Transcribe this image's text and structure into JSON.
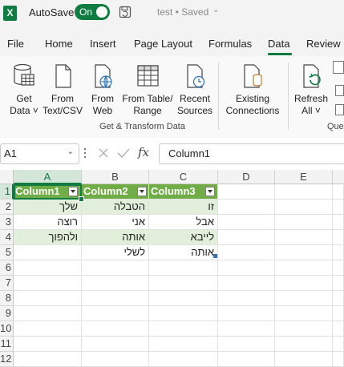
{
  "titlebar": {
    "app_icon": "X",
    "autosave_label": "AutoSave",
    "autosave_state": "On",
    "doc_title": "test • Saved",
    "icons": [
      "excel-logo-icon",
      "save-icon",
      "chevron-down-icon"
    ]
  },
  "tabs": [
    "File",
    "Home",
    "Insert",
    "Page Layout",
    "Formulas",
    "Data",
    "Review"
  ],
  "active_tab": "Data",
  "ribbon": {
    "buttons": [
      {
        "line1": "Get",
        "line2": "Data ˅",
        "icon": "database-icon"
      },
      {
        "line1": "From",
        "line2": "Text/CSV",
        "icon": "text-file-icon"
      },
      {
        "line1": "From",
        "line2": "Web",
        "icon": "web-icon"
      },
      {
        "line1": "From Table/",
        "line2": "Range",
        "icon": "table-icon"
      },
      {
        "line1": "Recent",
        "line2": "Sources",
        "icon": "recent-sources-icon"
      },
      {
        "line1": "Existing",
        "line2": "Connections",
        "icon": "connections-icon"
      },
      {
        "line1": "Refresh",
        "line2": "All ˅",
        "icon": "refresh-icon"
      }
    ],
    "group_label": "Get & Transform Data",
    "group_label_partial": "Que"
  },
  "formula_bar": {
    "name_box": "A1",
    "fx": "fx",
    "value": "Column1"
  },
  "grid": {
    "columns": [
      "A",
      "B",
      "C",
      "D",
      "E"
    ],
    "rows": [
      "1",
      "2",
      "3",
      "4",
      "5",
      "6",
      "7",
      "8",
      "9",
      "10",
      "11",
      "12"
    ],
    "table_headers": [
      "Column1",
      "Column2",
      "Column3"
    ],
    "table_rows": [
      [
        "שלך",
        "הטבלה",
        "זו"
      ],
      [
        "רוצה",
        "אני",
        "אבל"
      ],
      [
        "ולהפוך",
        "אותה",
        "לייבא"
      ],
      [
        "",
        "לשלי",
        "אותה"
      ]
    ],
    "table_style": {
      "header": "#70ad47",
      "band": "#e2efda"
    }
  }
}
